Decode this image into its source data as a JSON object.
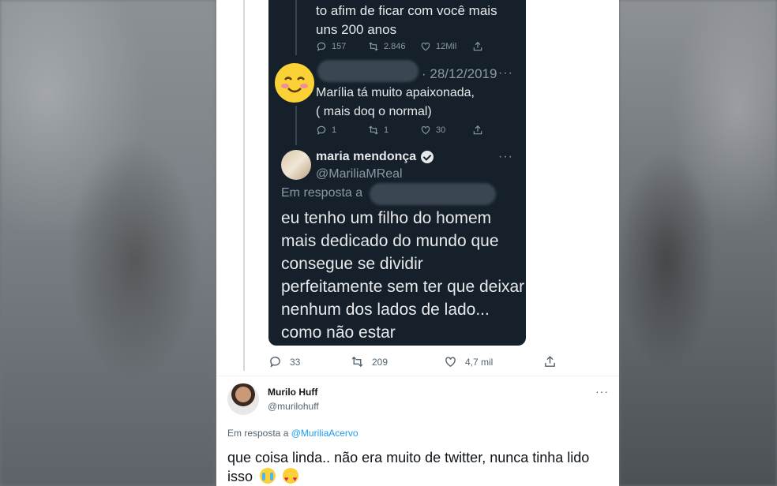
{
  "embedded_screenshot": {
    "tweet1": {
      "text": "to afim de ficar com você mais uns 200 anos",
      "replies": "157",
      "retweets": "2.846",
      "likes": "12Mil"
    },
    "tweet2": {
      "date": "· 28/12/2019",
      "text_line1": "Marília tá muito apaixonada,",
      "text_line2": "( mais doq o normal)",
      "replies": "1",
      "retweets": "1",
      "likes": "30"
    },
    "tweet3": {
      "author_name": "maria mendonça",
      "author_handle": "@MariliaMReal",
      "reply_prefix": "Em resposta a",
      "text": "eu tenho um filho do homem mais dedicado do mundo que consegue se dividir perfeitamente sem ter que deixar nenhum dos lados de lado... como não estar"
    }
  },
  "main_tweet_actions": {
    "replies": "33",
    "retweets": "209",
    "likes": "4,7 mil"
  },
  "reply_tweet": {
    "author_name": "Murilo Huff",
    "author_handle": "@murilohuff",
    "reply_prefix": "Em resposta a",
    "reply_to": "@MuriliaAcervo",
    "text": "que coisa linda.. não era muito de twitter, nunca tinha lido isso",
    "more_label": "···"
  },
  "icons": [
    "reply-icon",
    "retweet-icon",
    "like-icon",
    "share-icon",
    "verified-icon",
    "more-icon"
  ],
  "colors": {
    "dark_bg": "#15202b",
    "link": "#1d9bf0",
    "muted": "#536471"
  }
}
